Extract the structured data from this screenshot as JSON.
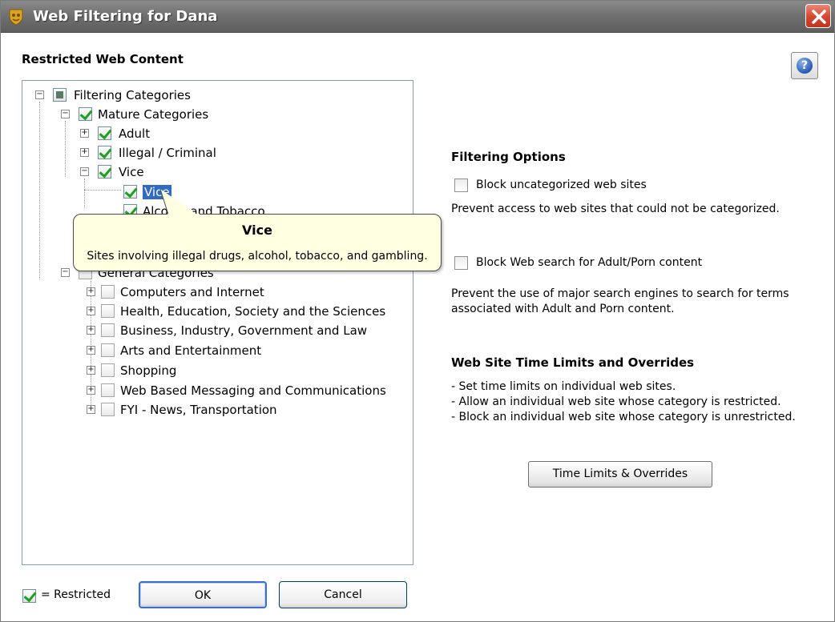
{
  "window": {
    "title": "Web Filtering for Dana",
    "close_icon": "close-icon"
  },
  "heading": "Restricted Web Content",
  "help_icon_glyph": "?",
  "tree": {
    "root": {
      "label": "Filtering Categories",
      "state": "partial"
    },
    "mature": {
      "label": "Mature Categories",
      "state": "checked"
    },
    "mature_children": [
      {
        "label": "Adult",
        "state": "checked"
      },
      {
        "label": "Illegal / Criminal",
        "state": "checked"
      },
      {
        "label": "Vice",
        "state": "checked"
      }
    ],
    "vice_children": [
      {
        "label": "Vice",
        "state": "checked",
        "selected": true
      },
      {
        "label": "Alcohol and Tobacco",
        "state": "checked"
      }
    ],
    "general": {
      "label": "General Categories",
      "state": "unchecked"
    },
    "general_children": [
      {
        "label": "Computers and Internet"
      },
      {
        "label": "Health, Education, Society and the Sciences"
      },
      {
        "label": "Business, Industry, Government and Law"
      },
      {
        "label": "Arts and Entertainment"
      },
      {
        "label": "Shopping"
      },
      {
        "label": "Web Based Messaging and Communications"
      },
      {
        "label": "FYI - News, Transportation"
      }
    ]
  },
  "tooltip": {
    "title": "Vice",
    "body": "Sites involving illegal drugs, alcohol, tobacco, and gambling."
  },
  "filtering_options": {
    "title": "Filtering Options",
    "block_uncategorized": {
      "label": "Block uncategorized web sites",
      "checked": false,
      "desc": "Prevent access to web sites that could not be categorized."
    },
    "block_search": {
      "label": "Block Web search for Adult/Porn content",
      "checked": false,
      "desc_line1": "Prevent the use of major search engines to search for terms",
      "desc_line2": "associated with Adult and Porn content."
    }
  },
  "time_limits": {
    "title": "Web Site Time Limits and Overrides",
    "lines": [
      "- Set time limits on individual web sites.",
      "- Allow an individual web site whose category is restricted.",
      "- Block an individual web site whose category is unrestricted."
    ],
    "button": "Time Limits & Overrides"
  },
  "footer": {
    "legend": "= Restricted",
    "ok": "OK",
    "cancel": "Cancel"
  }
}
